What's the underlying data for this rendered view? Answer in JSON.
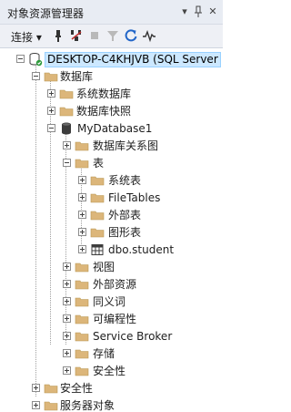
{
  "window": {
    "title": "对象资源管理器",
    "pin_icon": "pin-icon",
    "close_icon": "close-icon",
    "dropdown_icon": "dropdown-arrow-icon"
  },
  "toolbar": {
    "connect_label": "连接",
    "connect_arrow": "▾"
  },
  "tree": {
    "server": "DESKTOP-C4KHJVB (SQL Server",
    "databases": "数据库",
    "system_databases": "系统数据库",
    "db_snapshots": "数据库快照",
    "mydb": "MyDatabase1",
    "db_diagrams": "数据库关系图",
    "tables": "表",
    "system_tables": "系统表",
    "filetables": "FileTables",
    "external_tables": "外部表",
    "graph_tables": "图形表",
    "dbo_student": "dbo.student",
    "views": "视图",
    "external_resources": "外部资源",
    "synonyms": "同义词",
    "programmability": "可编程性",
    "service_broker": "Service Broker",
    "storage": "存储",
    "db_security": "安全性",
    "security": "安全性",
    "server_objects": "服务器对象"
  },
  "colors": {
    "selection": "#cce8ff",
    "folder": "#dcb67a",
    "accent": "#2266c8"
  }
}
